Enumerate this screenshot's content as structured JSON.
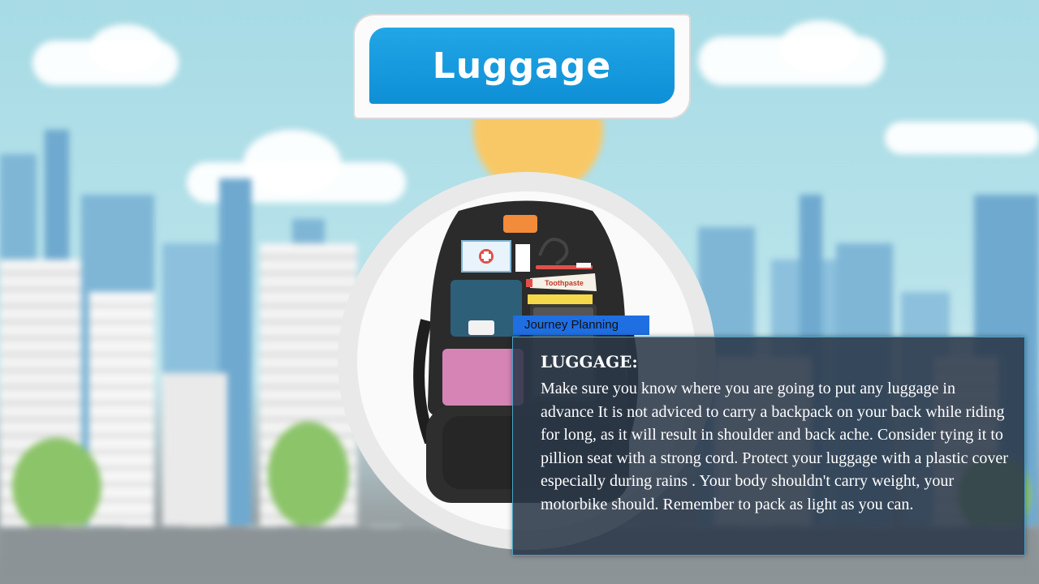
{
  "title": "Luggage",
  "tag_label": "Journey Planning",
  "panel": {
    "heading": "LUGGAGE:",
    "body": "Make sure you know where you are going to put any luggage in advance It is not adviced to carry a backpack on your back while riding for long, as it will result in shoulder and back ache. Consider tying it to pillion seat with a strong cord. Protect your luggage with a  plastic cover especially during rains . Your body shouldn't carry weight, your motorbike should. Remember to pack as light as you can."
  },
  "backpack": {
    "toothpaste_label": "Toothpaste",
    "icons": [
      "first-aid-kit-icon",
      "toothpaste-icon",
      "toothbrush-icon",
      "comb-icon",
      "shirt-icon",
      "charger-icon"
    ]
  },
  "colors": {
    "title_blue": "#1b9be0",
    "tag_blue": "#1f6fe3",
    "panel_bg": "#2b3849",
    "backpack": "#2b2b2b"
  }
}
